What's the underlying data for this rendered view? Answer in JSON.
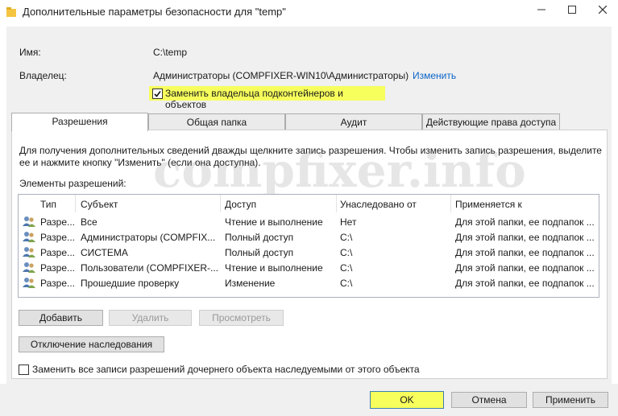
{
  "window": {
    "title": "Дополнительные параметры безопасности  для \"temp\""
  },
  "info": {
    "name_label": "Имя:",
    "name_value": "C:\\temp",
    "owner_label": "Владелец:",
    "owner_value": "Администраторы (COMPFIXER-WIN10\\Администраторы)",
    "owner_change": "Изменить",
    "replace_owner": "Заменить владельца подконтейнеров и объектов",
    "replace_owner_checked": true
  },
  "tabs": [
    {
      "label": "Разрешения",
      "active": true
    },
    {
      "label": "Общая папка"
    },
    {
      "label": "Аудит"
    },
    {
      "label": "Действующие права доступа"
    }
  ],
  "permissions": {
    "hint_line1": "Для получения дополнительных сведений дважды щелкните запись разрешения. Чтобы изменить запись разрешения, выделите",
    "hint_line2": "ее и нажмите кнопку \"Изменить\" (если она доступна).",
    "list_label": "Элементы разрешений:",
    "columns": [
      "Тип",
      "Субъект",
      "Доступ",
      "Унаследовано от",
      "Применяется к"
    ],
    "rows": [
      {
        "type": "Разре...",
        "subject": "Все",
        "access": "Чтение и выполнение",
        "inherited": "Нет",
        "applies": "Для этой папки, ее подпапок ..."
      },
      {
        "type": "Разре...",
        "subject": "Администраторы (COMPFIX...",
        "access": "Полный доступ",
        "inherited": "C:\\",
        "applies": "Для этой папки, ее подпапок ..."
      },
      {
        "type": "Разре...",
        "subject": "СИСТЕМА",
        "access": "Полный доступ",
        "inherited": "C:\\",
        "applies": "Для этой папки, ее подпапок ..."
      },
      {
        "type": "Разре...",
        "subject": "Пользователи (COMPFIXER-...",
        "access": "Чтение и выполнение",
        "inherited": "C:\\",
        "applies": "Для этой папки, ее подпапок ..."
      },
      {
        "type": "Разре...",
        "subject": "Прошедшие проверку",
        "access": "Изменение",
        "inherited": "C:\\",
        "applies": "Для этой папки, ее подпапок ..."
      }
    ],
    "btn_add": "Добавить",
    "btn_remove": "Удалить",
    "btn_view": "Просмотреть",
    "btn_disable_inheritance": "Отключение наследования",
    "replace_child": "Заменить все записи разрешений дочернего объекта наследуемыми от этого объекта",
    "replace_child_checked": false
  },
  "watermark": "compfixer.info",
  "footer": {
    "ok": "OK",
    "cancel": "Отмена",
    "apply": "Применить"
  }
}
